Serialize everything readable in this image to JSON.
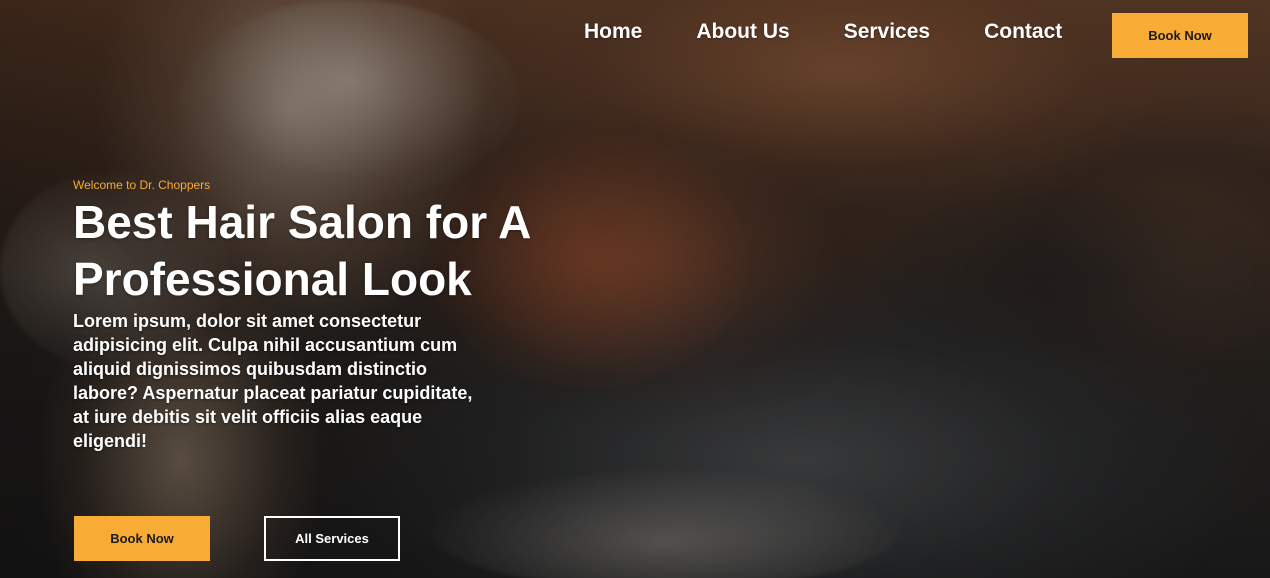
{
  "nav": {
    "links": [
      "Home",
      "About Us",
      "Services",
      "Contact"
    ],
    "cta_label": "Book Now"
  },
  "hero": {
    "eyebrow": "Welcome to Dr. Choppers",
    "headline_line1": "Best Hair Salon for A",
    "headline_line2": "Professional Look",
    "body": "Lorem ipsum, dolor sit amet consectetur adipisicing elit. Culpa nihil accusantium cum aliquid dignissimos quibusdam distinctio labore? Aspernatur placeat pariatur cupiditate, at iure debitis sit velit officiis alias eaque eligendi!",
    "primary_button": "Book Now",
    "secondary_button": "All Services"
  },
  "colors": {
    "accent": "#f8ac35",
    "text": "#ffffff"
  }
}
